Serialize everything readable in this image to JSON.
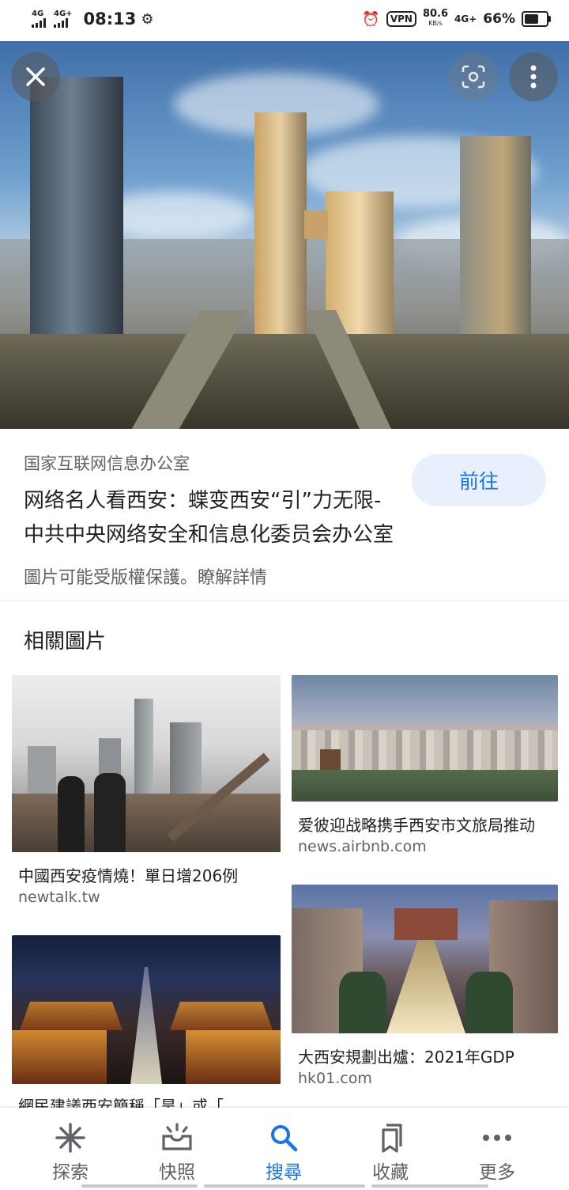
{
  "status_bar": {
    "signal1": "4G",
    "signal2": "4G+",
    "time": "08:13",
    "vpn": "VPN",
    "speed": "80.6",
    "speed_unit": "KB/s",
    "network": "4G+",
    "battery_percent": "66%",
    "battery_level": 0.66
  },
  "hero": {
    "icons": {
      "close": "close-icon",
      "lens": "lens-icon",
      "more": "more-vert-icon"
    }
  },
  "info": {
    "source": "国家互联网信息办公室",
    "title": "网络名人看西安：蝶变西安“引”力无限-中共中央网络安全和信息化委员会办公室",
    "goto_label": "前往",
    "copyright": "圖片可能受版權保護。瞭解詳情"
  },
  "related": {
    "heading": "相關圖片",
    "items": [
      {
        "title": "中國西安疫情燒！單日增206例",
        "domain": "newtalk.tw"
      },
      {
        "title": "爱彼迎战略携手西安市文旅局推动",
        "domain": "news.airbnb.com"
      },
      {
        "title": "大西安規劃出爐：2021年GDP",
        "domain": "hk01.com"
      },
      {
        "title": "網民建議西安簡稱「昊」或「",
        "domain": ""
      }
    ]
  },
  "bottom_nav": {
    "items": [
      {
        "label": "探索",
        "icon": "asterisk-icon"
      },
      {
        "label": "快照",
        "icon": "snapshot-icon"
      },
      {
        "label": "搜尋",
        "icon": "search-icon"
      },
      {
        "label": "收藏",
        "icon": "bookmark-icon"
      },
      {
        "label": "更多",
        "icon": "more-horiz-icon"
      }
    ],
    "active_index": 2
  },
  "colors": {
    "accent": "#1a73e8",
    "button_bg": "#e8f0fe",
    "secondary_text": "#5f6368"
  }
}
